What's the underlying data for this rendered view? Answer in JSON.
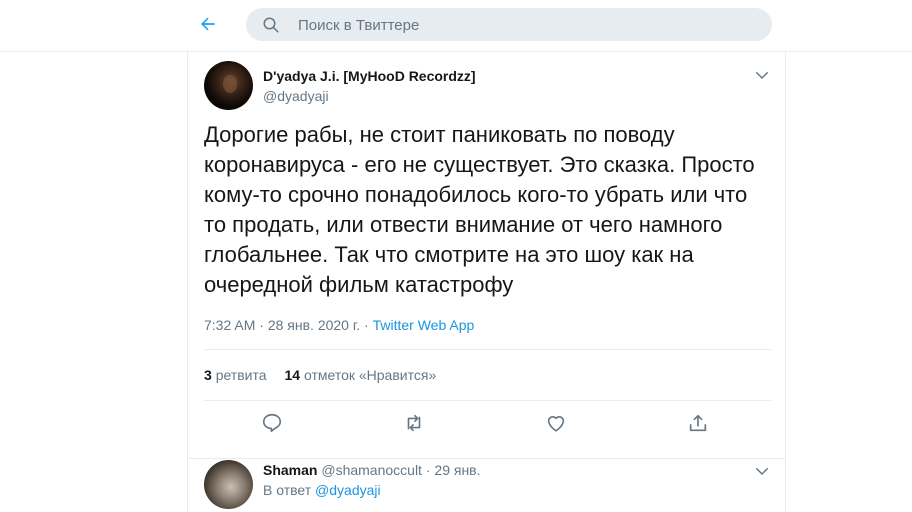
{
  "header": {
    "search_placeholder": "Поиск в Твиттере",
    "accent_color": "#1da1f2"
  },
  "tweet": {
    "author_name": "D'yadya J.i. [MyHooD Recordzz]",
    "author_handle": "@dyadyaji",
    "text": "Дорогие рабы, не стоит паниковать по поводу коронавируса - его не существует. Это сказка. Просто кому-то срочно понадобилось кого-то убрать или что то продать, или отвести внимание от чего намного глобальнее. Так что смотрите на это шоу как на очередной фильм катастрофу",
    "time": "7:32 AM",
    "date": "28 янв. 2020 г.",
    "separator": "·",
    "source": "Twitter Web App",
    "retweets_count": "3",
    "retweets_label": "ретвита",
    "likes_count": "14",
    "likes_label": "отметок «Нравится»"
  },
  "reply": {
    "author_name": "Shaman",
    "author_handle": "@shamanoccult",
    "separator": "·",
    "date": "29 янв.",
    "reply_prefix": "В ответ",
    "reply_to": "@dyadyaji"
  },
  "icons": [
    "back-arrow-icon",
    "search-icon",
    "chevron-down-icon",
    "reply-icon",
    "retweet-icon",
    "like-icon",
    "share-icon"
  ]
}
